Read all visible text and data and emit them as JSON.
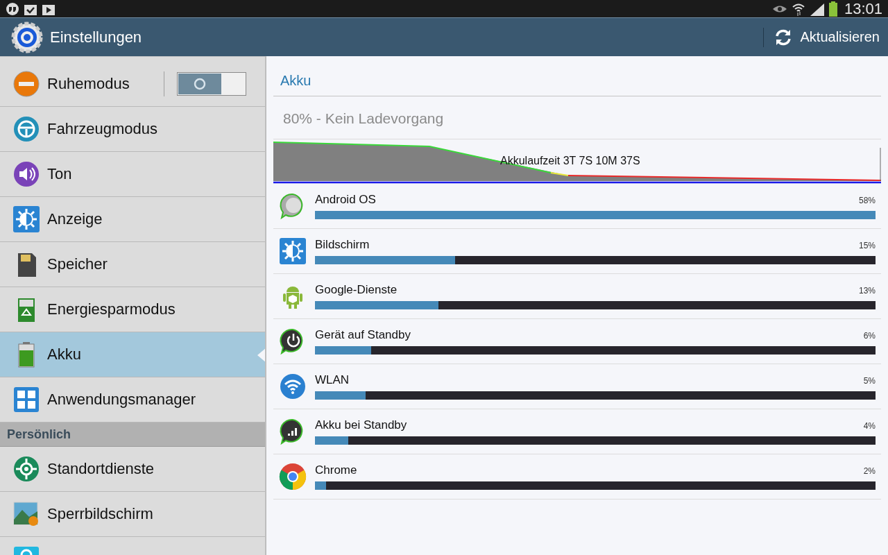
{
  "status_bar": {
    "time": "13:01"
  },
  "action_bar": {
    "title": "Einstellungen",
    "action": "Aktualisieren"
  },
  "sidebar": {
    "items": [
      {
        "kind": "toggle",
        "label": "Ruhemodus",
        "on": false,
        "selected": false
      },
      {
        "kind": "item",
        "label": "Fahrzeugmodus",
        "selected": false
      },
      {
        "kind": "item",
        "label": "Ton",
        "selected": false
      },
      {
        "kind": "item",
        "label": "Anzeige",
        "selected": false
      },
      {
        "kind": "item",
        "label": "Speicher",
        "selected": false
      },
      {
        "kind": "item",
        "label": "Energiesparmodus",
        "selected": false
      },
      {
        "kind": "item",
        "label": "Akku",
        "selected": true
      },
      {
        "kind": "item",
        "label": "Anwendungsmanager",
        "selected": false
      },
      {
        "kind": "header",
        "label": "Persönlich"
      },
      {
        "kind": "item",
        "label": "Standortdienste",
        "selected": false
      },
      {
        "kind": "item",
        "label": "Sperrbildschirm",
        "selected": false
      },
      {
        "kind": "partial",
        "selected": false
      }
    ]
  },
  "panel": {
    "title": "Akku",
    "status": "80% - Kein Ladevorgang",
    "chart_caption": "Akkulaufzeit 3T 7S 10M 37S",
    "apps": [
      {
        "name": "Android OS",
        "percent": "58%",
        "level": 1.0
      },
      {
        "name": "Bildschirm",
        "percent": "15%",
        "level": 0.25
      },
      {
        "name": "Google-Dienste",
        "percent": "13%",
        "level": 0.22
      },
      {
        "name": "Gerät auf Standby",
        "percent": "6%",
        "level": 0.1
      },
      {
        "name": "WLAN",
        "percent": "5%",
        "level": 0.09
      },
      {
        "name": "Akku bei Standby",
        "percent": "4%",
        "level": 0.06
      },
      {
        "name": "Chrome",
        "percent": "2%",
        "level": 0.02
      }
    ]
  }
}
